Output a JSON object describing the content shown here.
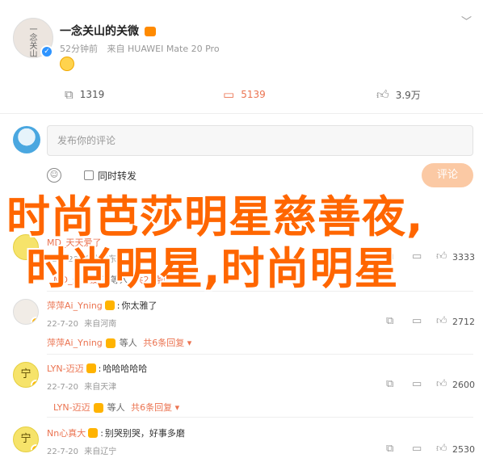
{
  "post": {
    "username": "一念关山的关微",
    "time": "52分钟前",
    "source_prefix": "来自",
    "source": "HUAWEI Mate 20 Pro",
    "avatar_text": "一念关山"
  },
  "actions": {
    "repost_count": "1319",
    "comment_count": "5139",
    "like_count": "3.9万"
  },
  "comment_box": {
    "placeholder": "发布你的评论",
    "also_repost_label": "同时转发",
    "submit_label": "评论"
  },
  "comments": [
    {
      "name": "MD_天天爱了",
      "text": "",
      "time": "22-7-20",
      "location": "来自山东",
      "likes": "3333",
      "avatar": "",
      "reply_name": "MD_天天爱了",
      "reply_suffix": "等人",
      "reply_count": "共29条回复"
    },
    {
      "name": "萍萍Ai_Yning",
      "text": "你太雅了",
      "time": "22-7-20",
      "location": "来自河南",
      "likes": "2712",
      "avatar": "",
      "reply_name": "萍萍Ai_Yning",
      "reply_suffix": "等人",
      "reply_count": "共6条回复"
    },
    {
      "name": "LYN-迈迈",
      "text": "哈哈哈哈哈",
      "time": "22-7-20",
      "location": "来自天津",
      "likes": "2600",
      "avatar": "宁",
      "reply_name": "LYN-迈迈",
      "reply_suffix": "等人",
      "reply_count": "共6条回复"
    },
    {
      "name": "Nn心真大",
      "text": "别哭别哭，好事多磨",
      "time": "22-7-20",
      "location": "来自辽宁",
      "likes": "2530",
      "avatar": "宁",
      "reply_name": "",
      "reply_suffix": "",
      "reply_count": ""
    }
  ],
  "overlay": {
    "line1": "时尚芭莎明星慈善夜,",
    "line2": "时尚明星,时尚明星"
  },
  "colors": {
    "accent": "#eb7350",
    "overlay": "#ff6600",
    "submit_bg": "#fbc9a4",
    "verified_blue": "#2e94ff"
  }
}
